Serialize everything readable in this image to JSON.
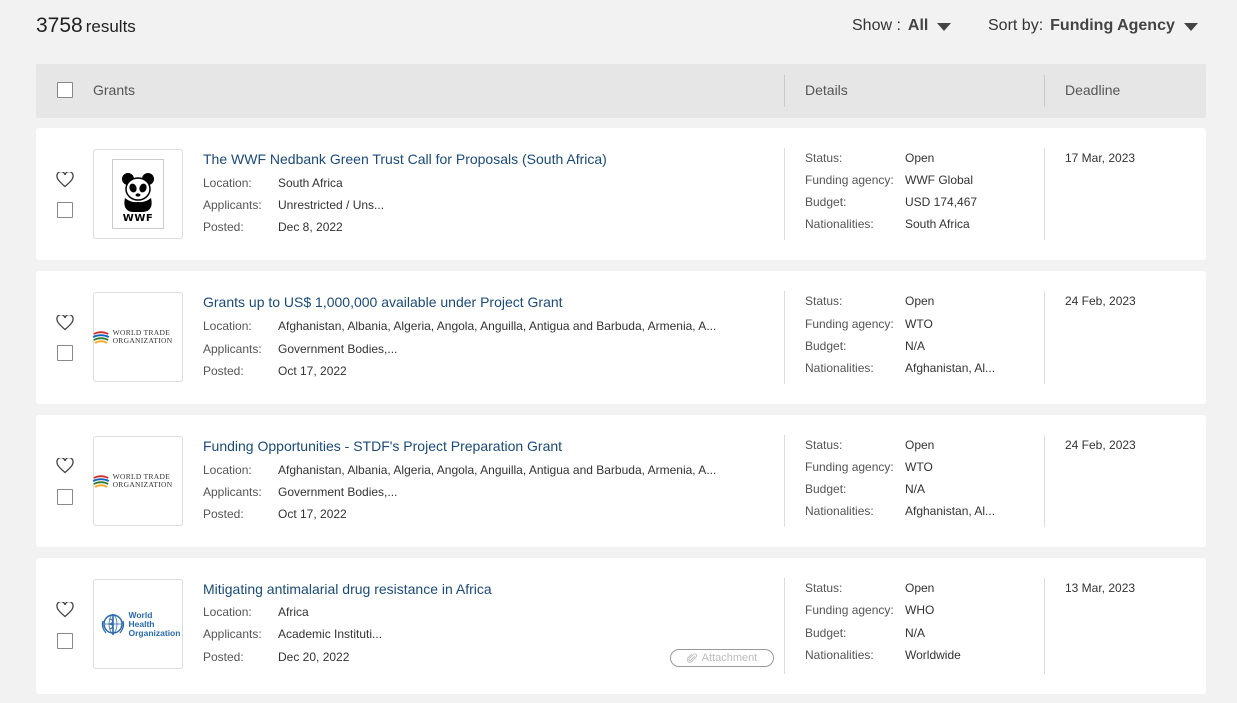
{
  "header": {
    "results_count": "3758",
    "results_label": "results",
    "show_label": "Show :",
    "show_value": "All",
    "sort_label": "Sort by:",
    "sort_value": "Funding Agency"
  },
  "table_header": {
    "grants": "Grants",
    "details": "Details",
    "deadline": "Deadline"
  },
  "field_labels": {
    "location": "Location:",
    "applicants": "Applicants:",
    "posted": "Posted:",
    "status": "Status:",
    "funding_agency": "Funding agency:",
    "budget": "Budget:",
    "nationalities": "Nationalities:"
  },
  "grants": [
    {
      "logo": "wwf",
      "logo_text": "WWF",
      "title": "The WWF Nedbank Green Trust Call for Proposals (South Africa)",
      "location": "South Africa",
      "applicants": "Unrestricted / Uns...",
      "posted": "Dec 8, 2022",
      "status": "Open",
      "funding_agency": "WWF Global",
      "budget": "USD 174,467",
      "nationalities": "South Africa",
      "deadline": "17 Mar, 2023"
    },
    {
      "logo": "wto",
      "logo_text": "WORLD TRADE ORGANIZATION",
      "title": "Grants up to US$ 1,000,000 available under Project Grant",
      "location": "Afghanistan, Albania, Algeria, Angola, Anguilla, Antigua and Barbuda, Armenia, A...",
      "applicants": "Government Bodies,...",
      "posted": "Oct 17, 2022",
      "status": "Open",
      "funding_agency": "WTO",
      "budget": "N/A",
      "nationalities": "Afghanistan, Al...",
      "deadline": "24 Feb, 2023"
    },
    {
      "logo": "wto",
      "logo_text": "WORLD TRADE ORGANIZATION",
      "title": "Funding Opportunities - STDF's Project Preparation Grant",
      "location": "Afghanistan, Albania, Algeria, Angola, Anguilla, Antigua and Barbuda, Armenia, A...",
      "applicants": "Government Bodies,...",
      "posted": "Oct 17, 2022",
      "status": "Open",
      "funding_agency": "WTO",
      "budget": "N/A",
      "nationalities": "Afghanistan, Al...",
      "deadline": "24 Feb, 2023"
    },
    {
      "logo": "who",
      "logo_text": "World Health Organization",
      "title": "Mitigating antimalarial drug resistance in Africa",
      "location": "Africa",
      "applicants": "Academic Instituti...",
      "posted": "Dec 20, 2022",
      "attachment": "Attachment",
      "status": "Open",
      "funding_agency": "WHO",
      "budget": "N/A",
      "nationalities": "Worldwide",
      "deadline": "13 Mar, 2023"
    }
  ],
  "colors": {
    "title_link": "#1a4a7a",
    "header_bg": "#e6e6e6",
    "page_bg": "#f2f2f2"
  }
}
